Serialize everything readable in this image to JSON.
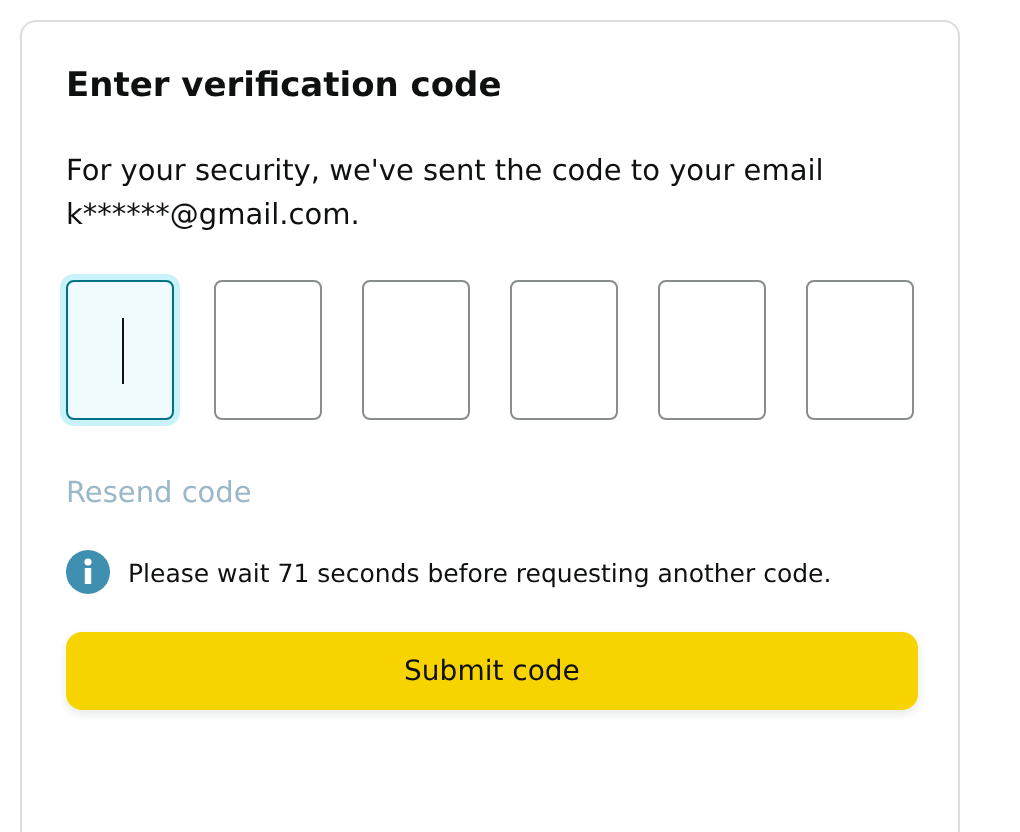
{
  "title": "Enter verification code",
  "message": "For your security, we've sent the code to your email k******@gmail.com.",
  "code_boxes": [
    {
      "focused": true
    },
    {
      "focused": false
    },
    {
      "focused": false
    },
    {
      "focused": false
    },
    {
      "focused": false
    },
    {
      "focused": false
    }
  ],
  "resend": {
    "label": "Resend code",
    "disabled": true
  },
  "notice": "Please wait 71 seconds before requesting another code.",
  "submit": "Submit code"
}
